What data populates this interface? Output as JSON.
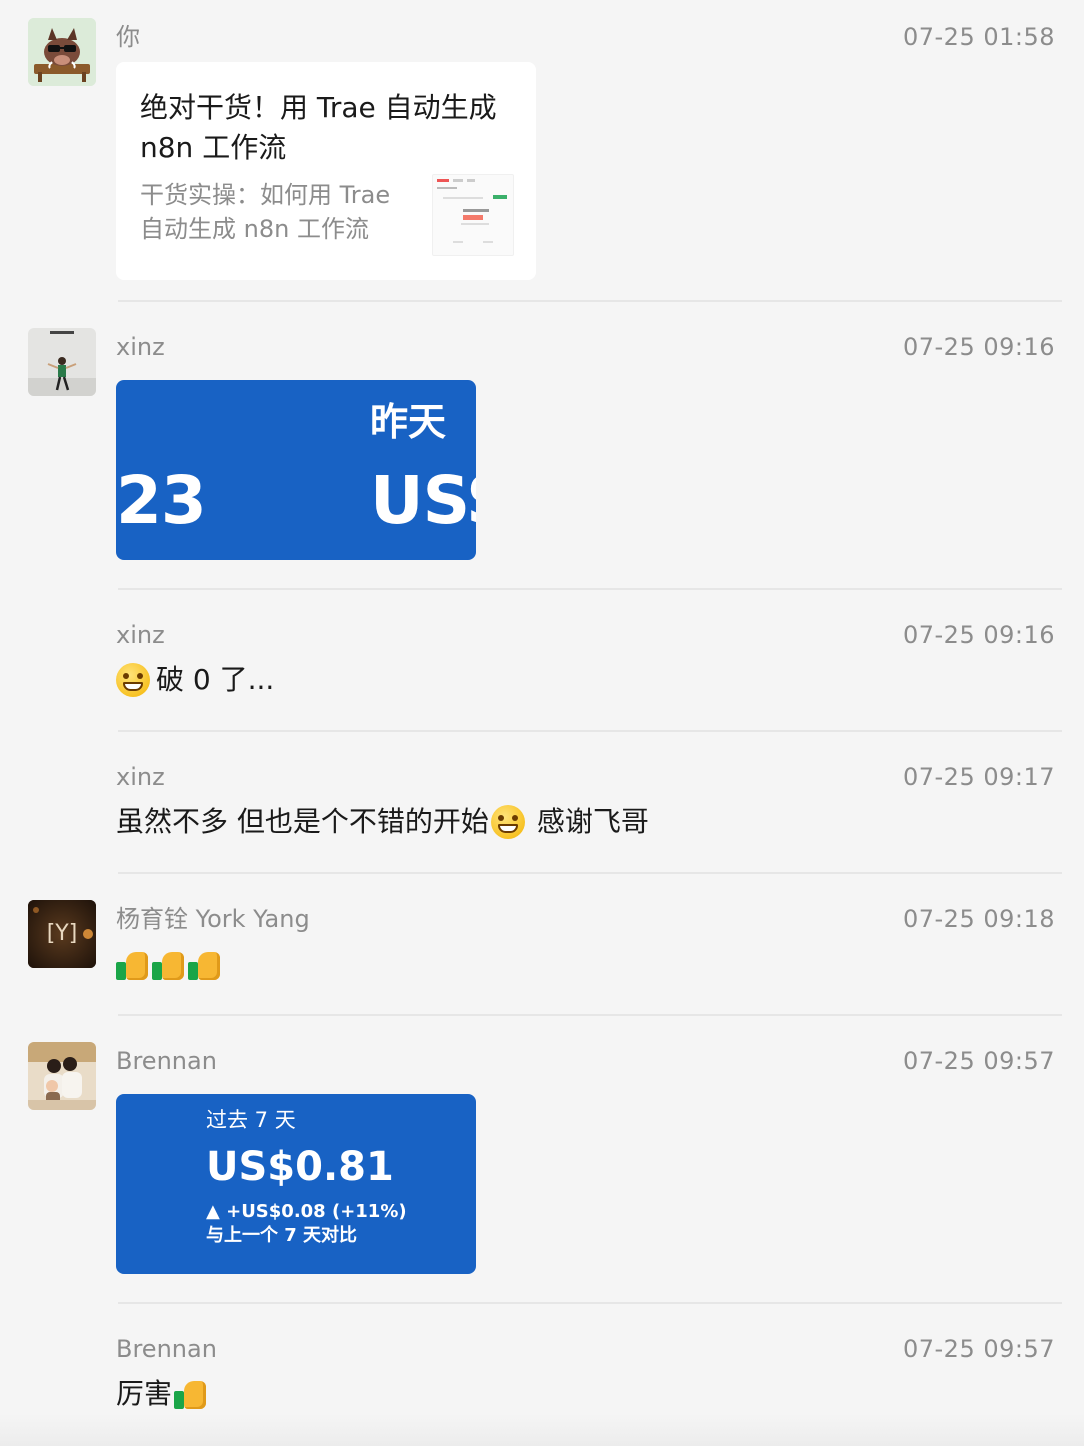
{
  "messages": [
    {
      "sender": "你",
      "time": "07-25 01:58",
      "card": {
        "title": "绝对干货！用 Trae 自动生成\nn8n 工作流",
        "desc": "干货实操：如何用 Trae\n自动生成 n8n 工作流"
      }
    },
    {
      "sender": "xinz",
      "time": "07-25 09:16",
      "image": {
        "label": "昨天",
        "number": "23",
        "currency": "USS"
      }
    },
    {
      "sender": "xinz",
      "time": "07-25 09:16",
      "text": "破 0 了..."
    },
    {
      "sender": "xinz",
      "time": "07-25 09:17",
      "text_a": "虽然不多 但也是个不错的开始",
      "text_b": "感谢飞哥"
    },
    {
      "sender": "杨育铨 York Yang",
      "time": "07-25 09:18"
    },
    {
      "sender": "Brennan",
      "time": "07-25 09:57",
      "image": {
        "label": "过去 7 天",
        "amount": "US$0.81",
        "change": "▲ +US$0.08 (+11%)",
        "compare": "与上一个 7 天对比"
      }
    },
    {
      "sender": "Brennan",
      "time": "07-25 09:57",
      "text": "厉害"
    }
  ],
  "avatar_labels": {
    "york": "[Y]"
  },
  "colors": {
    "bubble_blue": "#1862c4",
    "background": "#f5f5f5",
    "meta_gray": "#8c8c8c"
  }
}
